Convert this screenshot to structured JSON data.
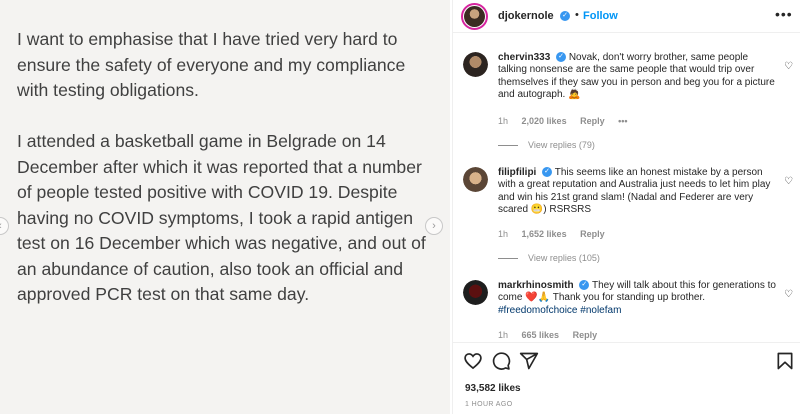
{
  "post": {
    "paragraphs": [
      "I want to emphasise that I have tried very hard to ensure the safety of everyone and my compliance with testing obligations.",
      "I attended a basketball game in Belgrade on 14 December after which it was reported that a number of people tested positive with COVID 19. Despite having no COVID symptoms, I took a rapid antigen test on 16 December which was negative, and out of an abundance of caution, also took an official and approved PCR test on that same day."
    ]
  },
  "header": {
    "username": "djokernole",
    "verified_glyph": "✓",
    "separator": "•",
    "follow_label": "Follow",
    "more_label": "•••"
  },
  "comments": [
    {
      "username": "chervin333",
      "text": "Novak, don't worry brother, same people talking nonsense are the same people that would trip over themselves if they saw you in person and beg you for a picture and autograph. 🙇",
      "time": "1h",
      "likes": "2,020 likes",
      "reply": "Reply",
      "options": "•••",
      "view_replies": "View replies (79)"
    },
    {
      "username": "filipfilipi",
      "text": "This seems like an honest mistake by a person with a great reputation and Australia just needs to let him play and win his 21st grand slam! (Nadal and Federer are very scared 😬) RSRSRS",
      "time": "1h",
      "likes": "1,652 likes",
      "reply": "Reply",
      "view_replies": "View replies (105)"
    },
    {
      "username": "markrhinosmith",
      "text": "They will talk about this for generations to come ❤️🙏 Thank you for standing up brother.",
      "tags": "#freedomofchoice #nolefam",
      "time": "1h",
      "likes": "665 likes",
      "reply": "Reply"
    }
  ],
  "footer": {
    "likes": "93,582 likes",
    "time": "1 HOUR AGO"
  },
  "icons": {
    "heart": "heart-icon",
    "comment": "comment-icon",
    "share": "share-icon",
    "bookmark": "bookmark-icon"
  },
  "colors": {
    "accent": "#0095f6",
    "verified": "#3897f0",
    "muted": "#8e8e8e",
    "image_bg": "#f4f3f1"
  }
}
